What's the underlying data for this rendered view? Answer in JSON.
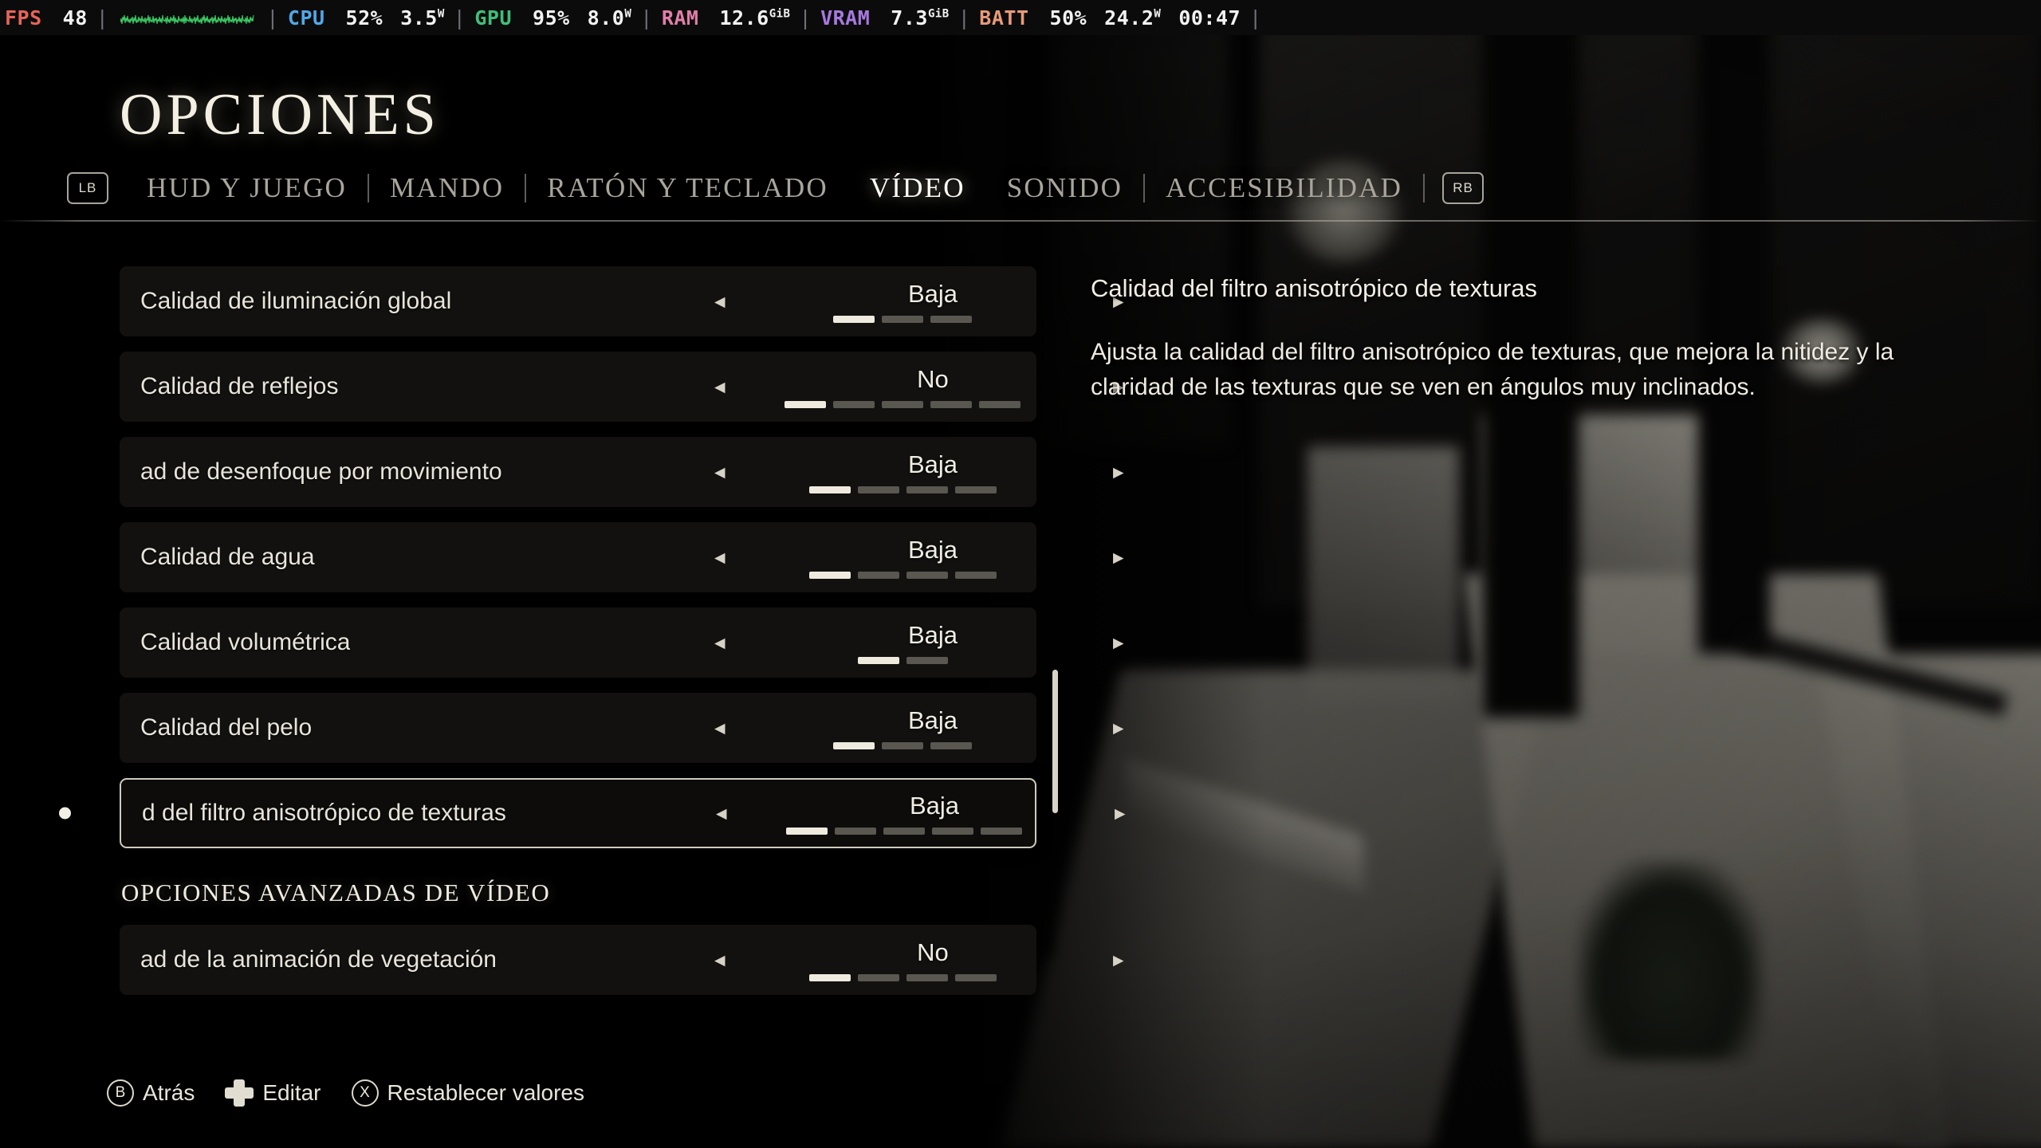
{
  "perf_overlay": {
    "items": [
      {
        "label": "FPS",
        "label_color": "#e8645a",
        "value": "48"
      },
      {
        "label": "CPU",
        "label_color": "#4fa8e8",
        "value": "52%",
        "value2": "3.5",
        "unit2": "W"
      },
      {
        "label": "GPU",
        "label_color": "#3fbf7a",
        "value": "95%",
        "value2": "8.0",
        "unit2": "W"
      },
      {
        "label": "RAM",
        "label_color": "#e07fa8",
        "value": "12.6",
        "unit": "GiB"
      },
      {
        "label": "VRAM",
        "label_color": "#a879e0",
        "value": "7.3",
        "unit": "GiB"
      },
      {
        "label": "BATT",
        "label_color": "#e89a7a",
        "value": "50%",
        "value2": "24.2",
        "unit2": "W",
        "value3": "00:47"
      }
    ],
    "graph_color": "#3fd96a",
    "separator": "|"
  },
  "header": {
    "title": "OPCIONES"
  },
  "tabs": {
    "left_bumper": "LB",
    "right_bumper": "RB",
    "items": [
      {
        "label": "HUD Y JUEGO",
        "active": false
      },
      {
        "label": "MANDO",
        "active": false
      },
      {
        "label": "RATÓN Y TECLADO",
        "active": false
      },
      {
        "label": "VÍDEO",
        "active": true
      },
      {
        "label": "SONIDO",
        "active": false
      },
      {
        "label": "ACCESIBILIDAD",
        "active": false
      }
    ]
  },
  "settings": {
    "rows": [
      {
        "label": "Calidad de iluminación global",
        "value": "Baja",
        "segments": 3,
        "filled": 1,
        "selected": false
      },
      {
        "label": "Calidad de reflejos",
        "value": "No",
        "segments": 5,
        "filled": 1,
        "selected": false
      },
      {
        "label": "ad de desenfoque por movimiento",
        "value": "Baja",
        "segments": 4,
        "filled": 1,
        "selected": false
      },
      {
        "label": "Calidad de agua",
        "value": "Baja",
        "segments": 4,
        "filled": 1,
        "selected": false
      },
      {
        "label": "Calidad volumétrica",
        "value": "Baja",
        "segments": 2,
        "filled": 1,
        "selected": false
      },
      {
        "label": "Calidad del pelo",
        "value": "Baja",
        "segments": 3,
        "filled": 1,
        "selected": false
      },
      {
        "label": "d del filtro anisotrópico de texturas",
        "value": "Baja",
        "segments": 5,
        "filled": 1,
        "selected": true
      }
    ],
    "advanced_section_header": "OPCIONES AVANZADAS DE VÍDEO",
    "advanced_rows": [
      {
        "label": "ad de la animación de vegetación",
        "value": "No",
        "segments": 4,
        "filled": 1,
        "selected": false
      }
    ],
    "arrow_left": "◂",
    "arrow_right": "▸"
  },
  "description": {
    "title": "Calidad del filtro anisotrópico de texturas",
    "body": "Ajusta la calidad del filtro anisotrópico de texturas, que mejora la nitidez y la claridad de las texturas que se ven en ángulos muy inclinados."
  },
  "footer": {
    "items": [
      {
        "glyph": "B",
        "glyph_type": "round",
        "label": "Atrás"
      },
      {
        "glyph": "",
        "glyph_type": "dpad",
        "label": "Editar"
      },
      {
        "glyph": "X",
        "glyph_type": "round",
        "label": "Restablecer valores"
      }
    ]
  }
}
